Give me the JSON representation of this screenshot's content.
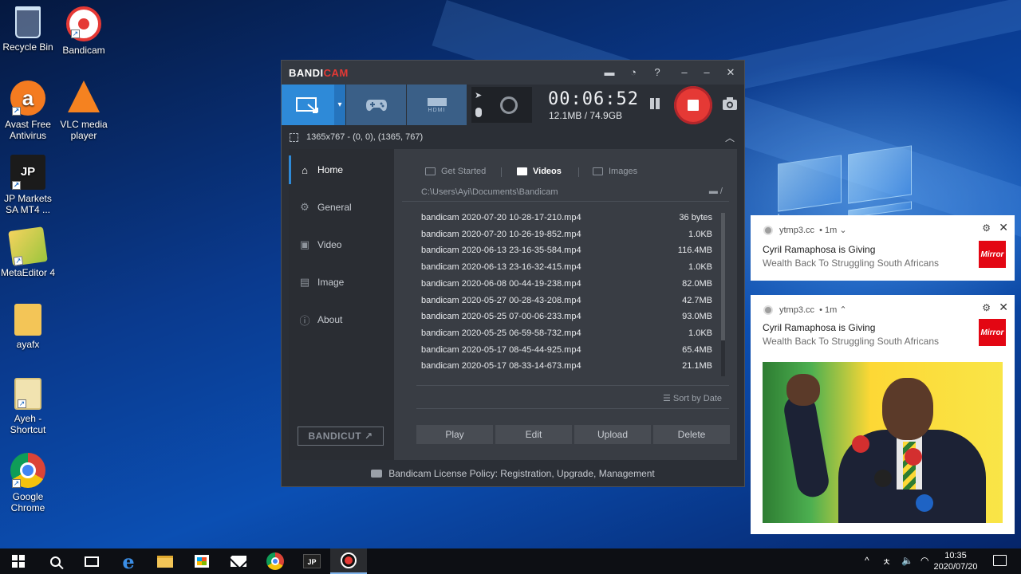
{
  "desktop": {
    "icons": [
      {
        "label": "Recycle Bin",
        "icon": "recycle-bin-icon"
      },
      {
        "label": "Bandicam",
        "icon": "bandicam-icon"
      },
      {
        "label": "Avast Free Antivirus",
        "icon": "avast-icon"
      },
      {
        "label": "VLC media player",
        "icon": "vlc-icon"
      },
      {
        "label": "JP Markets SA MT4 ...",
        "icon": "jp-markets-icon"
      },
      {
        "label": "MetaEditor 4",
        "icon": "metaeditor-icon"
      },
      {
        "label": "ayafx",
        "icon": "folder-icon"
      },
      {
        "label": "Ayeh - Shortcut",
        "icon": "document-shortcut-icon"
      },
      {
        "label": "Google Chrome",
        "icon": "chrome-icon"
      }
    ],
    "jp_icon_text": "JP"
  },
  "bandicam": {
    "logo_prefix": "BANDI",
    "logo_suffix": "CAM",
    "title_icons": [
      "folder-icon",
      "clock-icon",
      "help-icon",
      "minimize-icon",
      "restore-icon",
      "close-icon"
    ],
    "title_glyphs": {
      "folder": "▬",
      "clock": "◔",
      "help": "?",
      "minimize": "–",
      "restore": "–",
      "close": "✕"
    },
    "toolbar": {
      "modes": [
        "screen-recording-mode",
        "game-recording-mode",
        "device-recording-mode"
      ],
      "hdmi_label": "HDMI",
      "dropdown_glyph": "▾",
      "timer": "00:06:52",
      "size": "12.1MB / 74.9GB"
    },
    "area": {
      "text": "1365x767 - (0, 0), (1365, 767)",
      "collapse_glyph": "︿"
    },
    "sidebar": {
      "items": [
        {
          "label": "Home",
          "icon": "home-icon",
          "glyph": "⌂"
        },
        {
          "label": "General",
          "icon": "gear-icon",
          "glyph": "⚙"
        },
        {
          "label": "Video",
          "icon": "video-settings-icon",
          "glyph": "▣"
        },
        {
          "label": "Image",
          "icon": "image-settings-icon",
          "glyph": "▤"
        },
        {
          "label": "About",
          "icon": "info-icon",
          "glyph": "ⓘ"
        }
      ],
      "bandicut_label": "BANDICUT ↗"
    },
    "content": {
      "tabs": [
        "Get Started",
        "Videos",
        "Images"
      ],
      "path": "C:\\Users\\Ayi\\Documents\\Bandicam",
      "path_folder_glyph": "▬ /",
      "files": [
        {
          "name": "bandicam 2020-07-20 10-28-17-210.mp4",
          "size": "36 bytes"
        },
        {
          "name": "bandicam 2020-07-20 10-26-19-852.mp4",
          "size": "1.0KB"
        },
        {
          "name": "bandicam 2020-06-13 23-16-35-584.mp4",
          "size": "116.4MB"
        },
        {
          "name": "bandicam 2020-06-13 23-16-32-415.mp4",
          "size": "1.0KB"
        },
        {
          "name": "bandicam 2020-06-08 00-44-19-238.mp4",
          "size": "82.0MB"
        },
        {
          "name": "bandicam 2020-05-27 00-28-43-208.mp4",
          "size": "42.7MB"
        },
        {
          "name": "bandicam 2020-05-25 07-00-06-233.mp4",
          "size": "93.0MB"
        },
        {
          "name": "bandicam 2020-05-25 06-59-58-732.mp4",
          "size": "1.0KB"
        },
        {
          "name": "bandicam 2020-05-17 08-45-44-925.mp4",
          "size": "65.4MB"
        },
        {
          "name": "bandicam 2020-05-17 08-33-14-673.mp4",
          "size": "21.1MB"
        }
      ],
      "sort_label": "☰ Sort by Date",
      "actions": [
        "Play",
        "Edit",
        "Upload",
        "Delete"
      ]
    },
    "footer": "Bandicam License Policy: Registration, Upgrade, Management"
  },
  "notifications": [
    {
      "source": "ytmp3.cc",
      "time": "• 1m ⌄",
      "title": "Cyril Ramaphosa is Giving",
      "body": "Wealth Back To Struggling South Africans",
      "logo": "Mirror"
    },
    {
      "source": "ytmp3.cc",
      "time": "• 1m ⌃",
      "title": "Cyril Ramaphosa is Giving",
      "body": "Wealth Back To Struggling South Africans",
      "logo": "Mirror"
    }
  ],
  "notification_glyphs": {
    "gear": "⚙",
    "close": "✕"
  },
  "taskbar": {
    "apps": [
      "start",
      "search",
      "task-view",
      "edge",
      "file-explorer",
      "store",
      "mail",
      "chrome",
      "jp-markets",
      "bandicam"
    ],
    "edge_glyph": "e",
    "jp_label": "JP",
    "tray": {
      "chevron": "^",
      "lang": "ㅊ",
      "volume": "🔈",
      "wifi": "◠"
    },
    "clock_time": "10:35",
    "clock_date": "2020/07/20"
  },
  "colors": {
    "bandicam_accent": "#2e8ad8",
    "record_red": "#e53935",
    "mirror_red": "#e30613"
  }
}
